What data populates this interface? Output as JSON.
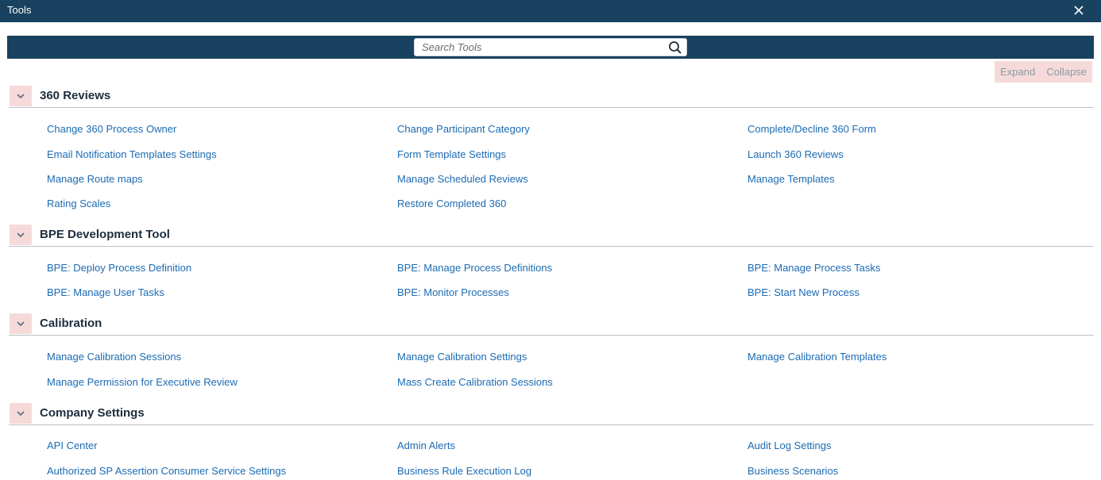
{
  "window": {
    "title": "Tools",
    "close_icon": "close-icon"
  },
  "search": {
    "placeholder": "Search Tools",
    "value": "",
    "icon": "search-icon"
  },
  "controls": {
    "expand_label": "Expand",
    "collapse_label": "Collapse"
  },
  "colors": {
    "header_bg": "#18425f",
    "link": "#1c6bb3",
    "chevron_bg": "#f6dada"
  },
  "sections": [
    {
      "title": "360 Reviews",
      "links": [
        "Change 360 Process Owner",
        "Change Participant Category",
        "Complete/Decline 360 Form",
        "Email Notification Templates Settings",
        "Form Template Settings",
        "Launch 360 Reviews",
        "Manage Route maps",
        "Manage Scheduled Reviews",
        "Manage Templates",
        "Rating Scales",
        "Restore Completed 360"
      ]
    },
    {
      "title": "BPE Development Tool",
      "links": [
        "BPE: Deploy Process Definition",
        "BPE: Manage Process Definitions",
        "BPE: Manage Process Tasks",
        "BPE: Manage User Tasks",
        "BPE: Monitor Processes",
        "BPE: Start New Process"
      ]
    },
    {
      "title": "Calibration",
      "links": [
        "Manage Calibration Sessions",
        "Manage Calibration Settings",
        "Manage Calibration Templates",
        "Manage Permission for Executive Review",
        "Mass Create Calibration Sessions"
      ]
    },
    {
      "title": "Company Settings",
      "links": [
        "API Center",
        "Admin Alerts",
        "Audit Log Settings",
        "Authorized SP Assertion Consumer Service Settings",
        "Business Rule Execution Log",
        "Business Scenarios"
      ]
    }
  ]
}
